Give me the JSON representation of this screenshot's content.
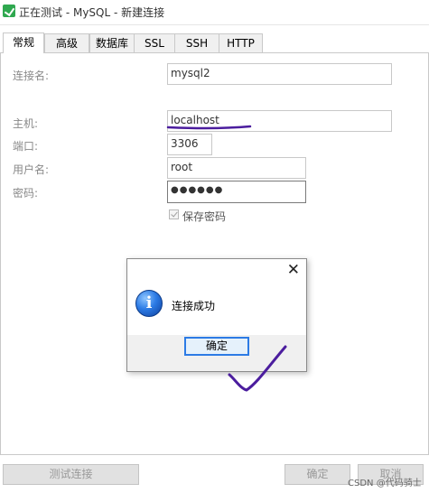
{
  "window": {
    "title": "正在测试 - MySQL - 新建连接"
  },
  "tabs": [
    "常规",
    "高级",
    "数据库",
    "SSL",
    "SSH",
    "HTTP"
  ],
  "form": {
    "connection_name_label": "连接名:",
    "connection_name_value": "mysql2",
    "host_label": "主机:",
    "host_value": "localhost",
    "port_label": "端口:",
    "port_value": "3306",
    "username_label": "用户名:",
    "username_value": "root",
    "password_label": "密码:",
    "password_value": "●●●●●●",
    "save_password_label": "保存密码",
    "save_password_checked": true
  },
  "dialog": {
    "message": "连接成功",
    "ok_label": "确定",
    "close_symbol": "✕",
    "icon": "info-icon"
  },
  "footer": {
    "test_connection_label": "测试连接",
    "ok_label": "确定",
    "cancel_label": "取消"
  },
  "watermark": "CSDN @代码骑士",
  "colors": {
    "annotation_ink": "#4b1d9e",
    "accent": "#2c7be5"
  }
}
